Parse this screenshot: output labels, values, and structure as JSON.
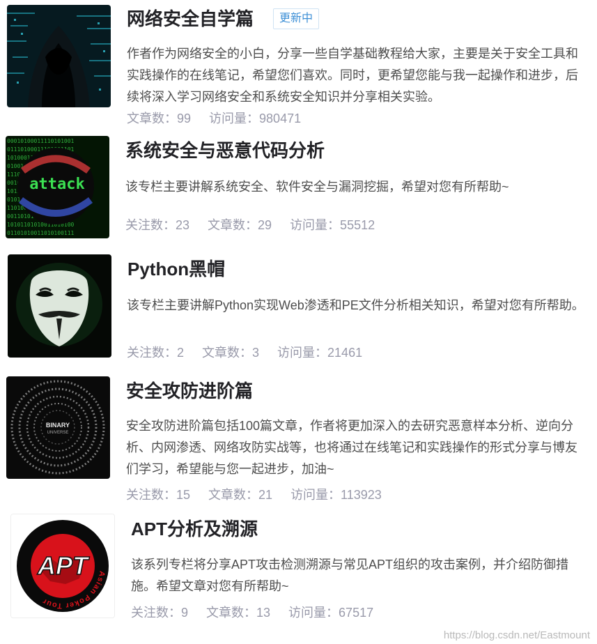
{
  "columns": [
    {
      "title": "网络安全自学篇",
      "badge": "更新中",
      "description": "作者作为网络安全的小白，分享一些自学基础教程给大家，主要是关于安全工具和实践操作的在线笔记，希望您们喜欢。同时，更希望您能与我一起操作和进步，后续将深入学习网络安全和系统安全知识并分享相关实验。",
      "articles": "文章数：99",
      "views": "访问量：980471"
    },
    {
      "title": "系统安全与恶意代码分析",
      "description": "该专栏主要讲解系统安全、软件安全与漏洞挖掘，希望对您有所帮助~",
      "followers": "关注数：23",
      "articles": "文章数：29",
      "views": "访问量：55512",
      "thumb_text": "attack"
    },
    {
      "title": "Python黑帽",
      "description": "该专栏主要讲解Python实现Web渗透和PE文件分析相关知识，希望对您有所帮助。",
      "followers": "关注数：2",
      "articles": "文章数：3",
      "views": "访问量：21461"
    },
    {
      "title": "安全攻防进阶篇",
      "description": "安全攻防进阶篇包括100篇文章，作者将更加深入的去研究恶意样本分析、逆向分析、内网渗透、网络攻防实战等，也将通过在线笔记和实践操作的形式分享与博友们学习，希望能与您一起进步，加油~",
      "followers": "关注数：15",
      "articles": "文章数：21",
      "views": "访问量：113923",
      "thumb_text_1": "BINARY",
      "thumb_text_2": "UNIVERSE"
    },
    {
      "title": "APT分析及溯源",
      "description": "该系列专栏将分享APT攻击检测溯源与常见APT组织的攻击案例，并介绍防御措施。希望文章对您有所帮助~",
      "followers": "关注数：9",
      "articles": "文章数：13",
      "views": "访问量：67517",
      "thumb_text": "APT",
      "thumb_ring_text": "Asian Poker Tour"
    }
  ],
  "watermark": "https://blog.csdn.net/Eastmount",
  "colors": {
    "title": "#222226",
    "description": "#4d4d4d",
    "stats": "#999aaa",
    "badge": "#3d8fd6",
    "apt_red": "#d8121b"
  }
}
